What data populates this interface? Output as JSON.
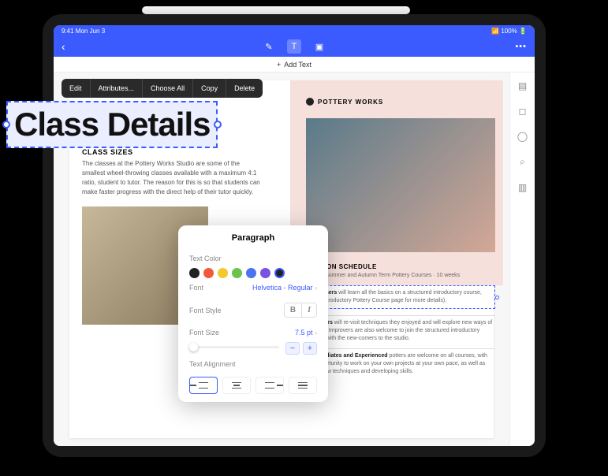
{
  "statusbar": {
    "time": "9:41  Mon Jun 3",
    "right": "📶 100% 🔋"
  },
  "addtext": "Add Text",
  "contextmenu": [
    "Edit",
    "Attributes...",
    "Choose All",
    "Copy",
    "Delete"
  ],
  "selected_text": "Class Details",
  "doc": {
    "brand": "POTTERY WORKS",
    "class_sizes_hdr": "CLASS SIZES",
    "class_sizes_body": "The classes at the Pottery Works Studio are some of the smallest wheel-throwing classes available with a maximum 4:1 ratio, student to tutor. The reason for this is so that students can make faster progress with the direct help of their tutor quickly.",
    "session_hdr": "SESSION SCHEDULE",
    "session_sub": "Spring, Summer and Autumn Term Pottery Courses · 10 weeks",
    "levels": [
      {
        "b": "Beginners",
        "t": " will learn all the basics on a structured introductory course, (see Introductory Pottery Course page for more details)."
      },
      {
        "b": "Improvers",
        "t": " will re-visit techniques they enjoyed and will explore new ways of creating. Improvers are also welcome to join the structured introductory lessons with the new-comers to the studio."
      },
      {
        "b": "Intermediates and Experienced",
        "t": " potters are welcome on all courses, with the opportunity to work on your own projects at your own pace, as well as trying new techniques and developing skills."
      }
    ]
  },
  "panel": {
    "title": "Paragraph",
    "textcolor_label": "Text Color",
    "colors": [
      "#222",
      "#f05a3c",
      "#f2c930",
      "#6cc24a",
      "#4a74f0",
      "#7a52e0",
      "#222"
    ],
    "font_label": "Font",
    "font_value": "Helvetica - Regular",
    "fontstyle_label": "Font Style",
    "fontsize_label": "Font Size",
    "fontsize_value": "7.5 pt",
    "align_label": "Text Alignment"
  }
}
